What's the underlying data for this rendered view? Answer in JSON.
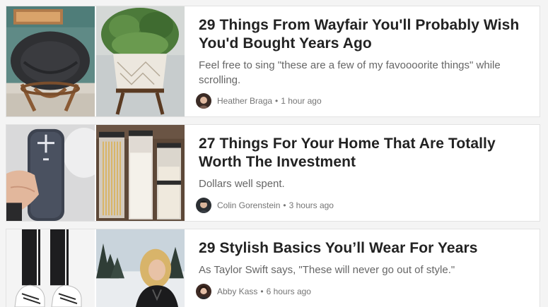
{
  "articles": [
    {
      "headline": "29 Things From Wayfair You'll Probably Wish You'd Bought Years Ago",
      "description": "Feel free to sing \"these are a few of my favoooorite things\" while scrolling.",
      "author": "Heather Braga",
      "separator": "•",
      "time": "1 hour ago",
      "images": [
        "papasan-chair-photo",
        "potted-plant-photo"
      ]
    },
    {
      "headline": "27 Things For Your Home That Are Totally Worth The Investment",
      "description": "Dollars well spent.",
      "author": "Colin Gorenstein",
      "separator": "•",
      "time": "3 hours ago",
      "images": [
        "bluetooth-speaker-photo",
        "pantry-containers-photo"
      ]
    },
    {
      "headline": "29 Stylish Basics You’ll Wear For Years",
      "description": "As Taylor Swift says, \"These will never go out of style.\"",
      "author": "Abby Kass",
      "separator": "•",
      "time": "6 hours ago",
      "images": [
        "sneakers-photo",
        "winter-portrait-photo"
      ]
    }
  ]
}
